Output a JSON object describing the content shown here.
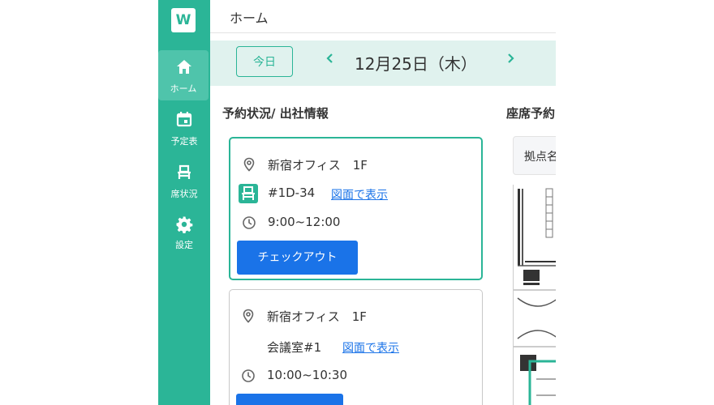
{
  "app": {
    "logo_letter": "W",
    "page_title": "ホーム",
    "accent": "#2bb597",
    "link_color": "#1a73e8"
  },
  "sidebar": {
    "items": [
      {
        "label": "ホーム",
        "icon": "home-icon",
        "active": true
      },
      {
        "label": "予定表",
        "icon": "calendar-icon",
        "active": false
      },
      {
        "label": "席状況",
        "icon": "seat-icon",
        "active": false
      },
      {
        "label": "設定",
        "icon": "gear-icon",
        "active": false
      }
    ]
  },
  "datebar": {
    "today_label": "今日",
    "date": "12月25日（木）"
  },
  "sections": {
    "reservation_title": "予約状況/ 出社情報",
    "seat_title": "座席予約"
  },
  "cards": [
    {
      "location": "新宿オフィス　1F",
      "seat": "#1D-34",
      "map_link": "図面で表示",
      "time": "9:00~12:00",
      "button": "チェックアウト"
    },
    {
      "location": "新宿オフィス　1F",
      "room": "会議室#1",
      "map_link": "図面で表示",
      "time": "10:00~10:30"
    }
  ],
  "filter": {
    "label": "拠点名"
  }
}
